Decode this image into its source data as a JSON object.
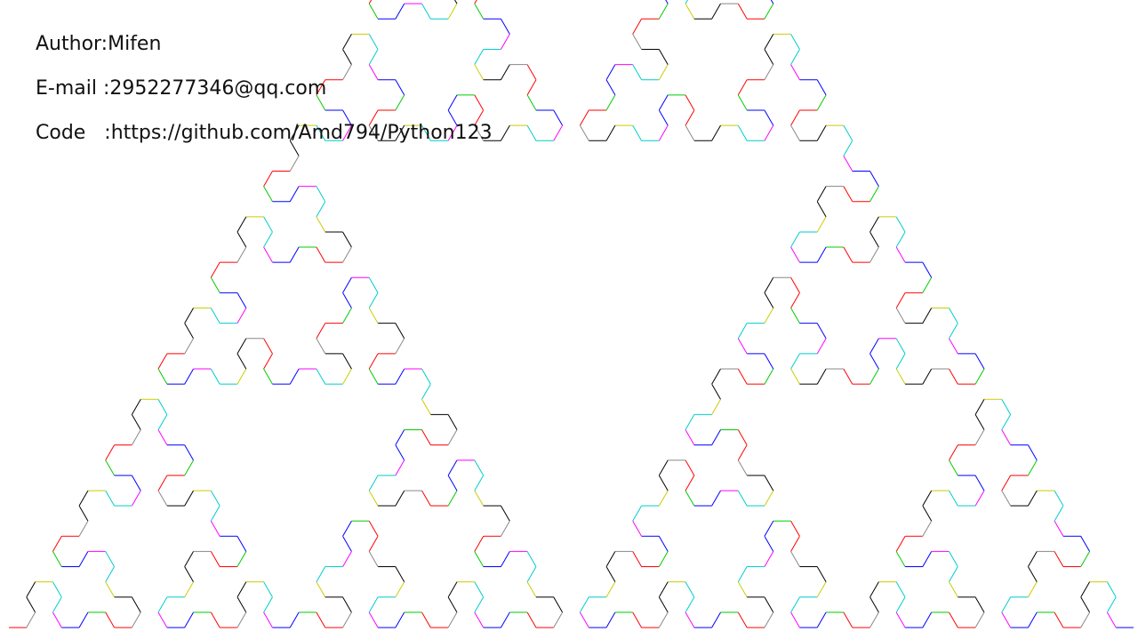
{
  "info": {
    "author": "Author:Mifen",
    "email": "E-mail :2952277346@qq.com",
    "code": "Code   :https://github.com/Amd794/Python123"
  },
  "fractal": {
    "description_icon": "sierpinski-arrowhead-curve",
    "palette": [
      "#ff0000",
      "#00cc00",
      "#0000ff",
      "#ff00ff",
      "#00cccc",
      "#cccc00",
      "#000000",
      "#888888"
    ]
  }
}
